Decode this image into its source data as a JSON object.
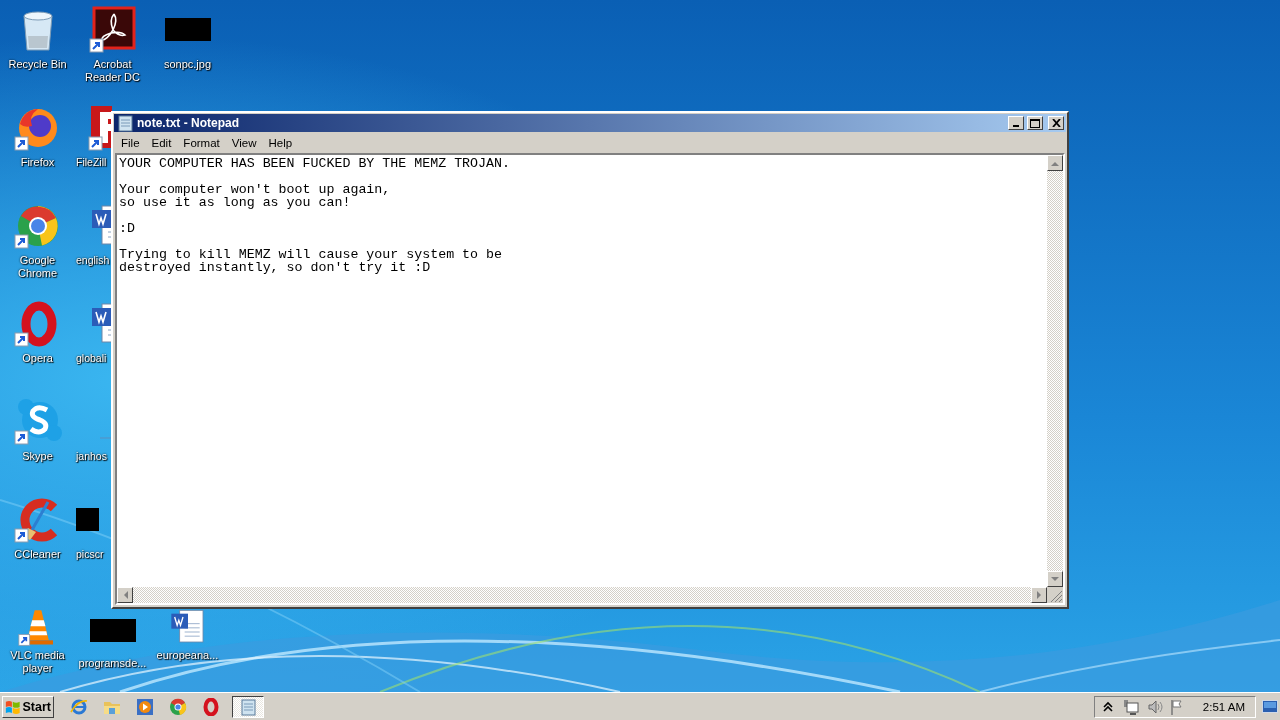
{
  "desktop": {
    "icon_columns": [
      [
        {
          "label": "Recycle Bin",
          "kind": "recycle",
          "shortcut": false,
          "cut_by_window": false
        },
        {
          "label": "Firefox",
          "kind": "firefox",
          "shortcut": true,
          "cut_by_window": false
        },
        {
          "label": "Google Chrome",
          "kind": "chrome",
          "shortcut": true,
          "cut_by_window": false
        },
        {
          "label": "Opera",
          "kind": "opera",
          "shortcut": true,
          "cut_by_window": false
        },
        {
          "label": "Skype",
          "kind": "skype",
          "shortcut": true,
          "cut_by_window": false
        },
        {
          "label": "CCleaner",
          "kind": "ccleaner",
          "shortcut": true,
          "cut_by_window": false
        },
        {
          "label": "VLC media player",
          "kind": "vlc",
          "shortcut": true,
          "cut_by_window": false
        }
      ],
      [
        {
          "label": "Acrobat Reader DC",
          "kind": "acrobat",
          "shortcut": true,
          "cut_by_window": false
        },
        {
          "label": "FileZill",
          "kind": "filezilla",
          "shortcut": true,
          "cut_by_window": true
        },
        {
          "label": "english",
          "kind": "word",
          "shortcut": false,
          "cut_by_window": true
        },
        {
          "label": "globali",
          "kind": "word",
          "shortcut": false,
          "cut_by_window": true
        },
        {
          "label": "janhos",
          "kind": "line",
          "shortcut": false,
          "cut_by_window": true
        },
        {
          "label": "picscr",
          "kind": "black",
          "shortcut": false,
          "cut_by_window": true
        },
        {
          "label": "programsde...",
          "kind": "black",
          "shortcut": false,
          "cut_by_window": false
        }
      ],
      [
        {
          "label": "sonpc.jpg",
          "kind": "black",
          "shortcut": false,
          "cut_by_window": false
        },
        {
          "label": "europeana...",
          "kind": "word",
          "shortcut": false,
          "cut_by_window": false
        }
      ]
    ]
  },
  "notepad": {
    "title": "note.txt - Notepad",
    "menu": [
      "File",
      "Edit",
      "Format",
      "View",
      "Help"
    ],
    "text": "YOUR COMPUTER HAS BEEN FUCKED BY THE MEMZ TROJAN.\n\nYour computer won't boot up again,\nso use it as long as you can!\n\n:D\n\nTrying to kill MEMZ will cause your system to be\ndestroyed instantly, so don't try it :D"
  },
  "taskbar": {
    "start": "Start",
    "quick_launch": [
      {
        "kind": "ie"
      },
      {
        "kind": "explorer"
      },
      {
        "kind": "media"
      },
      {
        "kind": "chrome"
      },
      {
        "kind": "opera"
      }
    ],
    "tasks": [
      {
        "kind": "notepad",
        "selected": true
      }
    ],
    "tray_icons": [
      {
        "kind": "chevron"
      },
      {
        "kind": "network"
      },
      {
        "kind": "volume"
      },
      {
        "kind": "flag"
      }
    ],
    "clock": "2:51 AM"
  }
}
